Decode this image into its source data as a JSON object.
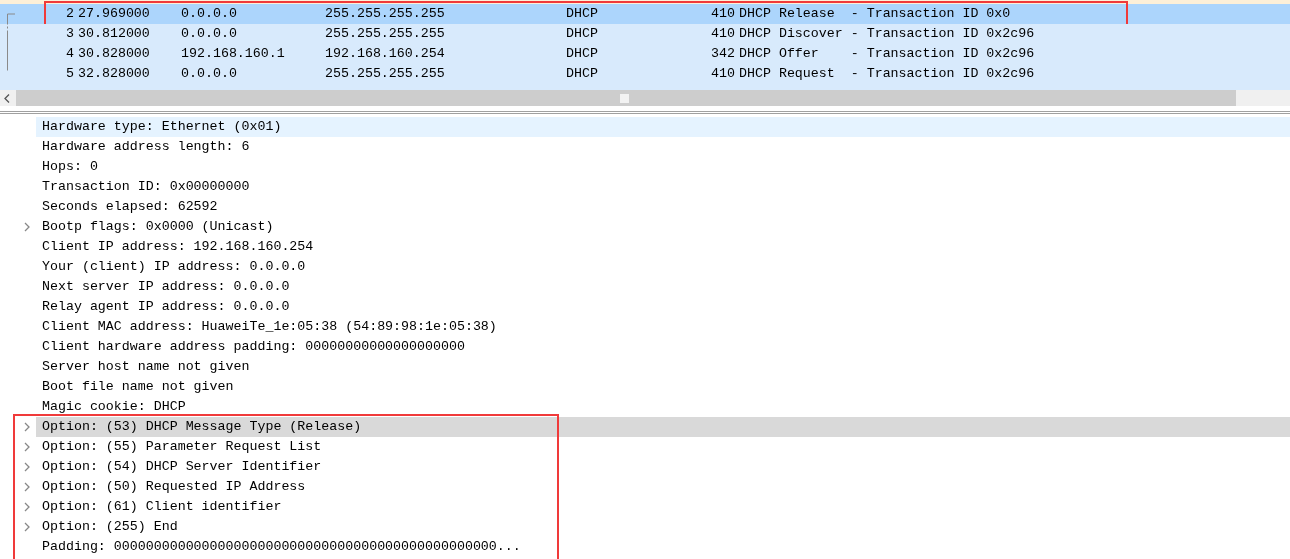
{
  "packet_list": {
    "rows": [
      {
        "no": "2",
        "time": "27.969000",
        "source": "0.0.0.0",
        "destination": "255.255.255.255",
        "protocol": "DHCP",
        "length": "410",
        "info": "DHCP Release  - Transaction ID 0x0",
        "selected": true,
        "annotated": true
      },
      {
        "no": "3",
        "time": "30.812000",
        "source": "0.0.0.0",
        "destination": "255.255.255.255",
        "protocol": "DHCP",
        "length": "410",
        "info": "DHCP Discover - Transaction ID 0x2c96",
        "selected": false,
        "annotated": false
      },
      {
        "no": "4",
        "time": "30.828000",
        "source": "192.168.160.1",
        "destination": "192.168.160.254",
        "protocol": "DHCP",
        "length": "342",
        "info": "DHCP Offer    - Transaction ID 0x2c96",
        "selected": false,
        "annotated": false
      },
      {
        "no": "5",
        "time": "32.828000",
        "source": "0.0.0.0",
        "destination": "255.255.255.255",
        "protocol": "DHCP",
        "length": "410",
        "info": "DHCP Request  - Transaction ID 0x2c96",
        "selected": false,
        "annotated": false
      }
    ]
  },
  "details": [
    {
      "annotated": false,
      "rows": [
        {
          "text": "Hardware type: Ethernet (0x01)",
          "expandable": false,
          "hovered": true,
          "selected": false
        },
        {
          "text": "Hardware address length: 6",
          "expandable": false,
          "hovered": false,
          "selected": false
        },
        {
          "text": "Hops: 0",
          "expandable": false,
          "hovered": false,
          "selected": false
        },
        {
          "text": "Transaction ID: 0x00000000",
          "expandable": false,
          "hovered": false,
          "selected": false
        },
        {
          "text": "Seconds elapsed: 62592",
          "expandable": false,
          "hovered": false,
          "selected": false
        },
        {
          "text": "Bootp flags: 0x0000 (Unicast)",
          "expandable": true,
          "hovered": false,
          "selected": false
        },
        {
          "text": "Client IP address: 192.168.160.254",
          "expandable": false,
          "hovered": false,
          "selected": false
        },
        {
          "text": "Your (client) IP address: 0.0.0.0",
          "expandable": false,
          "hovered": false,
          "selected": false
        },
        {
          "text": "Next server IP address: 0.0.0.0",
          "expandable": false,
          "hovered": false,
          "selected": false
        },
        {
          "text": "Relay agent IP address: 0.0.0.0",
          "expandable": false,
          "hovered": false,
          "selected": false
        },
        {
          "text": "Client MAC address: HuaweiTe_1e:05:38 (54:89:98:1e:05:38)",
          "expandable": false,
          "hovered": false,
          "selected": false
        },
        {
          "text": "Client hardware address padding: 00000000000000000000",
          "expandable": false,
          "hovered": false,
          "selected": false
        },
        {
          "text": "Server host name not given",
          "expandable": false,
          "hovered": false,
          "selected": false
        },
        {
          "text": "Boot file name not given",
          "expandable": false,
          "hovered": false,
          "selected": false
        },
        {
          "text": "Magic cookie: DHCP",
          "expandable": false,
          "hovered": false,
          "selected": false
        }
      ]
    },
    {
      "annotated": true,
      "rows": [
        {
          "text": "Option: (53) DHCP Message Type (Release)",
          "expandable": true,
          "hovered": false,
          "selected": true
        },
        {
          "text": "Option: (55) Parameter Request List",
          "expandable": true,
          "hovered": false,
          "selected": false
        },
        {
          "text": "Option: (54) DHCP Server Identifier",
          "expandable": true,
          "hovered": false,
          "selected": false
        },
        {
          "text": "Option: (50) Requested IP Address",
          "expandable": true,
          "hovered": false,
          "selected": false
        },
        {
          "text": "Option: (61) Client identifier",
          "expandable": true,
          "hovered": false,
          "selected": false
        },
        {
          "text": "Option: (255) End",
          "expandable": true,
          "hovered": false,
          "selected": false
        },
        {
          "text": "Padding: 000000000000000000000000000000000000000000000000...",
          "expandable": false,
          "hovered": false,
          "selected": false
        }
      ]
    }
  ]
}
